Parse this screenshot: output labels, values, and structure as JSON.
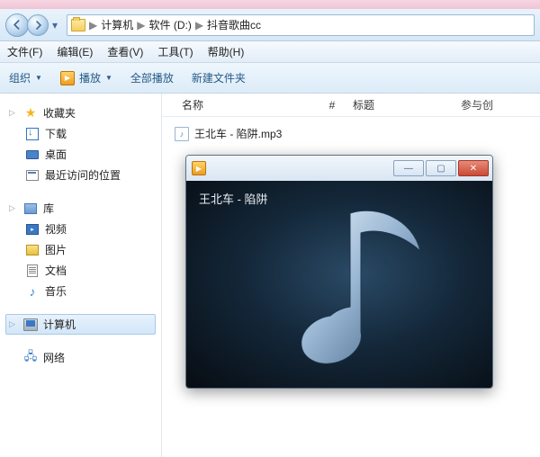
{
  "titlebar_stub": [
    "…",
    "…"
  ],
  "breadcrumb": {
    "sep": "▶",
    "parts": [
      "计算机",
      "软件 (D:)",
      "抖音歌曲cc"
    ]
  },
  "menus": {
    "file": "文件(F)",
    "edit": "编辑(E)",
    "view": "查看(V)",
    "tools": "工具(T)",
    "help": "帮助(H)"
  },
  "toolbar": {
    "organize": "组织",
    "play": "播放",
    "play_all": "全部播放",
    "new_folder": "新建文件夹"
  },
  "columns": {
    "name": "名称",
    "num": "#",
    "title": "标题",
    "contrib": "参与创"
  },
  "sidebar": {
    "favorites": {
      "label": "收藏夹",
      "items": [
        {
          "icon": "download",
          "label": "下载"
        },
        {
          "icon": "desktop",
          "label": "桌面"
        },
        {
          "icon": "recent",
          "label": "最近访问的位置"
        }
      ]
    },
    "libraries": {
      "label": "库",
      "items": [
        {
          "icon": "video",
          "label": "视频"
        },
        {
          "icon": "picture",
          "label": "图片"
        },
        {
          "icon": "document",
          "label": "文档"
        },
        {
          "icon": "music",
          "label": "音乐"
        }
      ]
    },
    "computer": {
      "label": "计算机"
    },
    "network": {
      "label": "网络"
    }
  },
  "files": [
    {
      "name": "王北车 - 陷阱.mp3"
    }
  ],
  "player": {
    "now_playing": "王北车 - 陷阱"
  }
}
